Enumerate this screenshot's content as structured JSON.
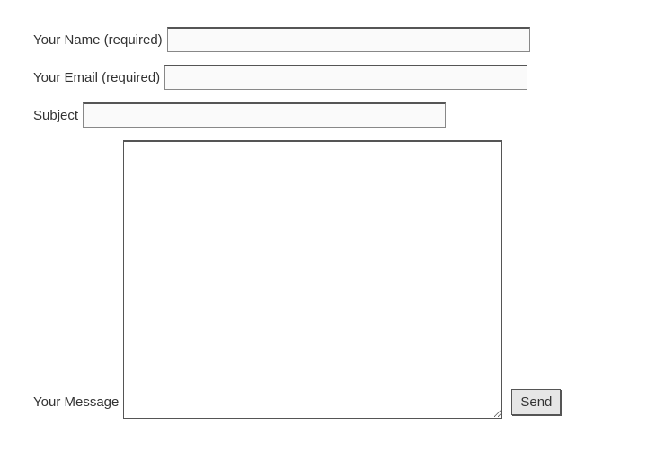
{
  "form": {
    "name": {
      "label": "Your Name (required)",
      "value": ""
    },
    "email": {
      "label": "Your Email (required)",
      "value": ""
    },
    "subject": {
      "label": "Subject",
      "value": ""
    },
    "message": {
      "label": "Your Message",
      "value": ""
    },
    "submit_label": "Send"
  }
}
